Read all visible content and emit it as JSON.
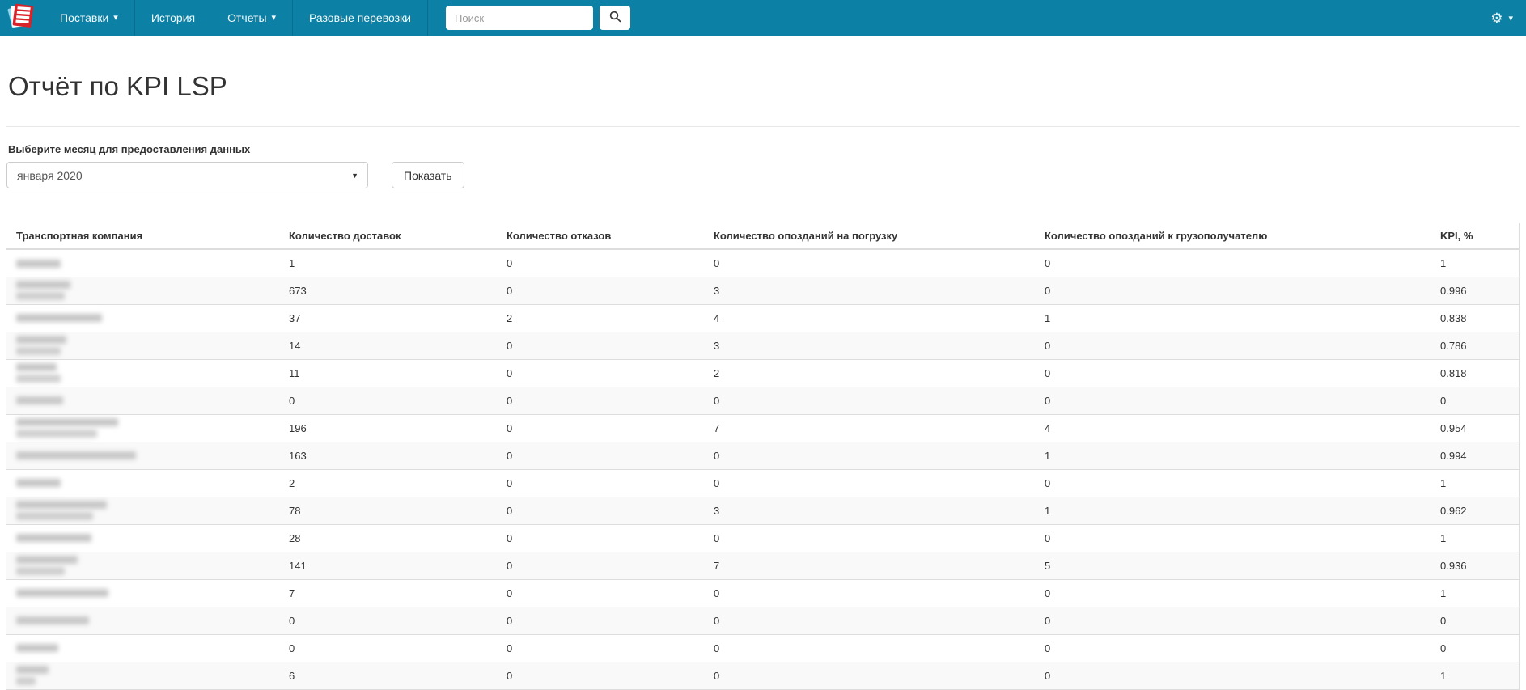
{
  "colors": {
    "navbar_bg": "#0d81a5",
    "navbar_divider": "#0a6d8c",
    "row_stripe": "#f9f9f9",
    "table_border": "#dddddd",
    "logo_red": "#d8232a",
    "logo_blue": "#8fd8f0"
  },
  "icons": {
    "gear": "⚙",
    "caret_down": "▾",
    "select_caret": "▼",
    "search": "magnifier"
  },
  "navbar": {
    "items": [
      {
        "label": "Поставки",
        "has_caret": true
      },
      {
        "label": "История",
        "has_caret": false
      },
      {
        "label": "Отчеты",
        "has_caret": true
      },
      {
        "label": "Разовые перевозки",
        "has_caret": false
      }
    ],
    "search_placeholder": "Поиск"
  },
  "page": {
    "title": "Отчёт по KPI LSP"
  },
  "filter": {
    "label": "Выберите месяц для предоставления данных",
    "selected_month": "января 2020",
    "show_button": "Показать"
  },
  "table": {
    "columns": [
      "Транспортная компания",
      "Количество доставок",
      "Количество отказов",
      "Количество опозданий на погрузку",
      "Количество опозданий к грузополучателю",
      "KPI, %"
    ],
    "rows": [
      {
        "company_redacted": true,
        "redaction_widths": [
          55
        ],
        "deliveries": "1",
        "refusals": "0",
        "loading_delays": "0",
        "consignee_delays": "0",
        "kpi": "1"
      },
      {
        "company_redacted": true,
        "redaction_widths": [
          67,
          60
        ],
        "deliveries": "673",
        "refusals": "0",
        "loading_delays": "3",
        "consignee_delays": "0",
        "kpi": "0.996"
      },
      {
        "company_redacted": true,
        "redaction_widths": [
          106
        ],
        "deliveries": "37",
        "refusals": "2",
        "loading_delays": "4",
        "consignee_delays": "1",
        "kpi": "0.838"
      },
      {
        "company_redacted": true,
        "redaction_widths": [
          62,
          55
        ],
        "deliveries": "14",
        "refusals": "0",
        "loading_delays": "3",
        "consignee_delays": "0",
        "kpi": "0.786"
      },
      {
        "company_redacted": true,
        "redaction_widths": [
          50,
          55
        ],
        "deliveries": "11",
        "refusals": "0",
        "loading_delays": "2",
        "consignee_delays": "0",
        "kpi": "0.818"
      },
      {
        "company_redacted": true,
        "redaction_widths": [
          58
        ],
        "deliveries": "0",
        "refusals": "0",
        "loading_delays": "0",
        "consignee_delays": "0",
        "kpi": "0"
      },
      {
        "company_redacted": true,
        "redaction_widths": [
          126,
          100
        ],
        "deliveries": "196",
        "refusals": "0",
        "loading_delays": "7",
        "consignee_delays": "4",
        "kpi": "0.954"
      },
      {
        "company_redacted": true,
        "redaction_widths": [
          148
        ],
        "deliveries": "163",
        "refusals": "0",
        "loading_delays": "0",
        "consignee_delays": "1",
        "kpi": "0.994"
      },
      {
        "company_redacted": true,
        "redaction_widths": [
          55
        ],
        "deliveries": "2",
        "refusals": "0",
        "loading_delays": "0",
        "consignee_delays": "0",
        "kpi": "1"
      },
      {
        "company_redacted": true,
        "redaction_widths": [
          112,
          95
        ],
        "deliveries": "78",
        "refusals": "0",
        "loading_delays": "3",
        "consignee_delays": "1",
        "kpi": "0.962"
      },
      {
        "company_redacted": true,
        "redaction_widths": [
          93
        ],
        "deliveries": "28",
        "refusals": "0",
        "loading_delays": "0",
        "consignee_delays": "0",
        "kpi": "1"
      },
      {
        "company_redacted": true,
        "redaction_widths": [
          76,
          60
        ],
        "deliveries": "141",
        "refusals": "0",
        "loading_delays": "7",
        "consignee_delays": "5",
        "kpi": "0.936"
      },
      {
        "company_redacted": true,
        "redaction_widths": [
          114
        ],
        "deliveries": "7",
        "refusals": "0",
        "loading_delays": "0",
        "consignee_delays": "0",
        "kpi": "1"
      },
      {
        "company_redacted": true,
        "redaction_widths": [
          90
        ],
        "deliveries": "0",
        "refusals": "0",
        "loading_delays": "0",
        "consignee_delays": "0",
        "kpi": "0"
      },
      {
        "company_redacted": true,
        "redaction_widths": [
          52
        ],
        "deliveries": "0",
        "refusals": "0",
        "loading_delays": "0",
        "consignee_delays": "0",
        "kpi": "0"
      },
      {
        "company_redacted": true,
        "redaction_widths": [
          40,
          24
        ],
        "deliveries": "6",
        "refusals": "0",
        "loading_delays": "0",
        "consignee_delays": "0",
        "kpi": "1"
      }
    ]
  }
}
